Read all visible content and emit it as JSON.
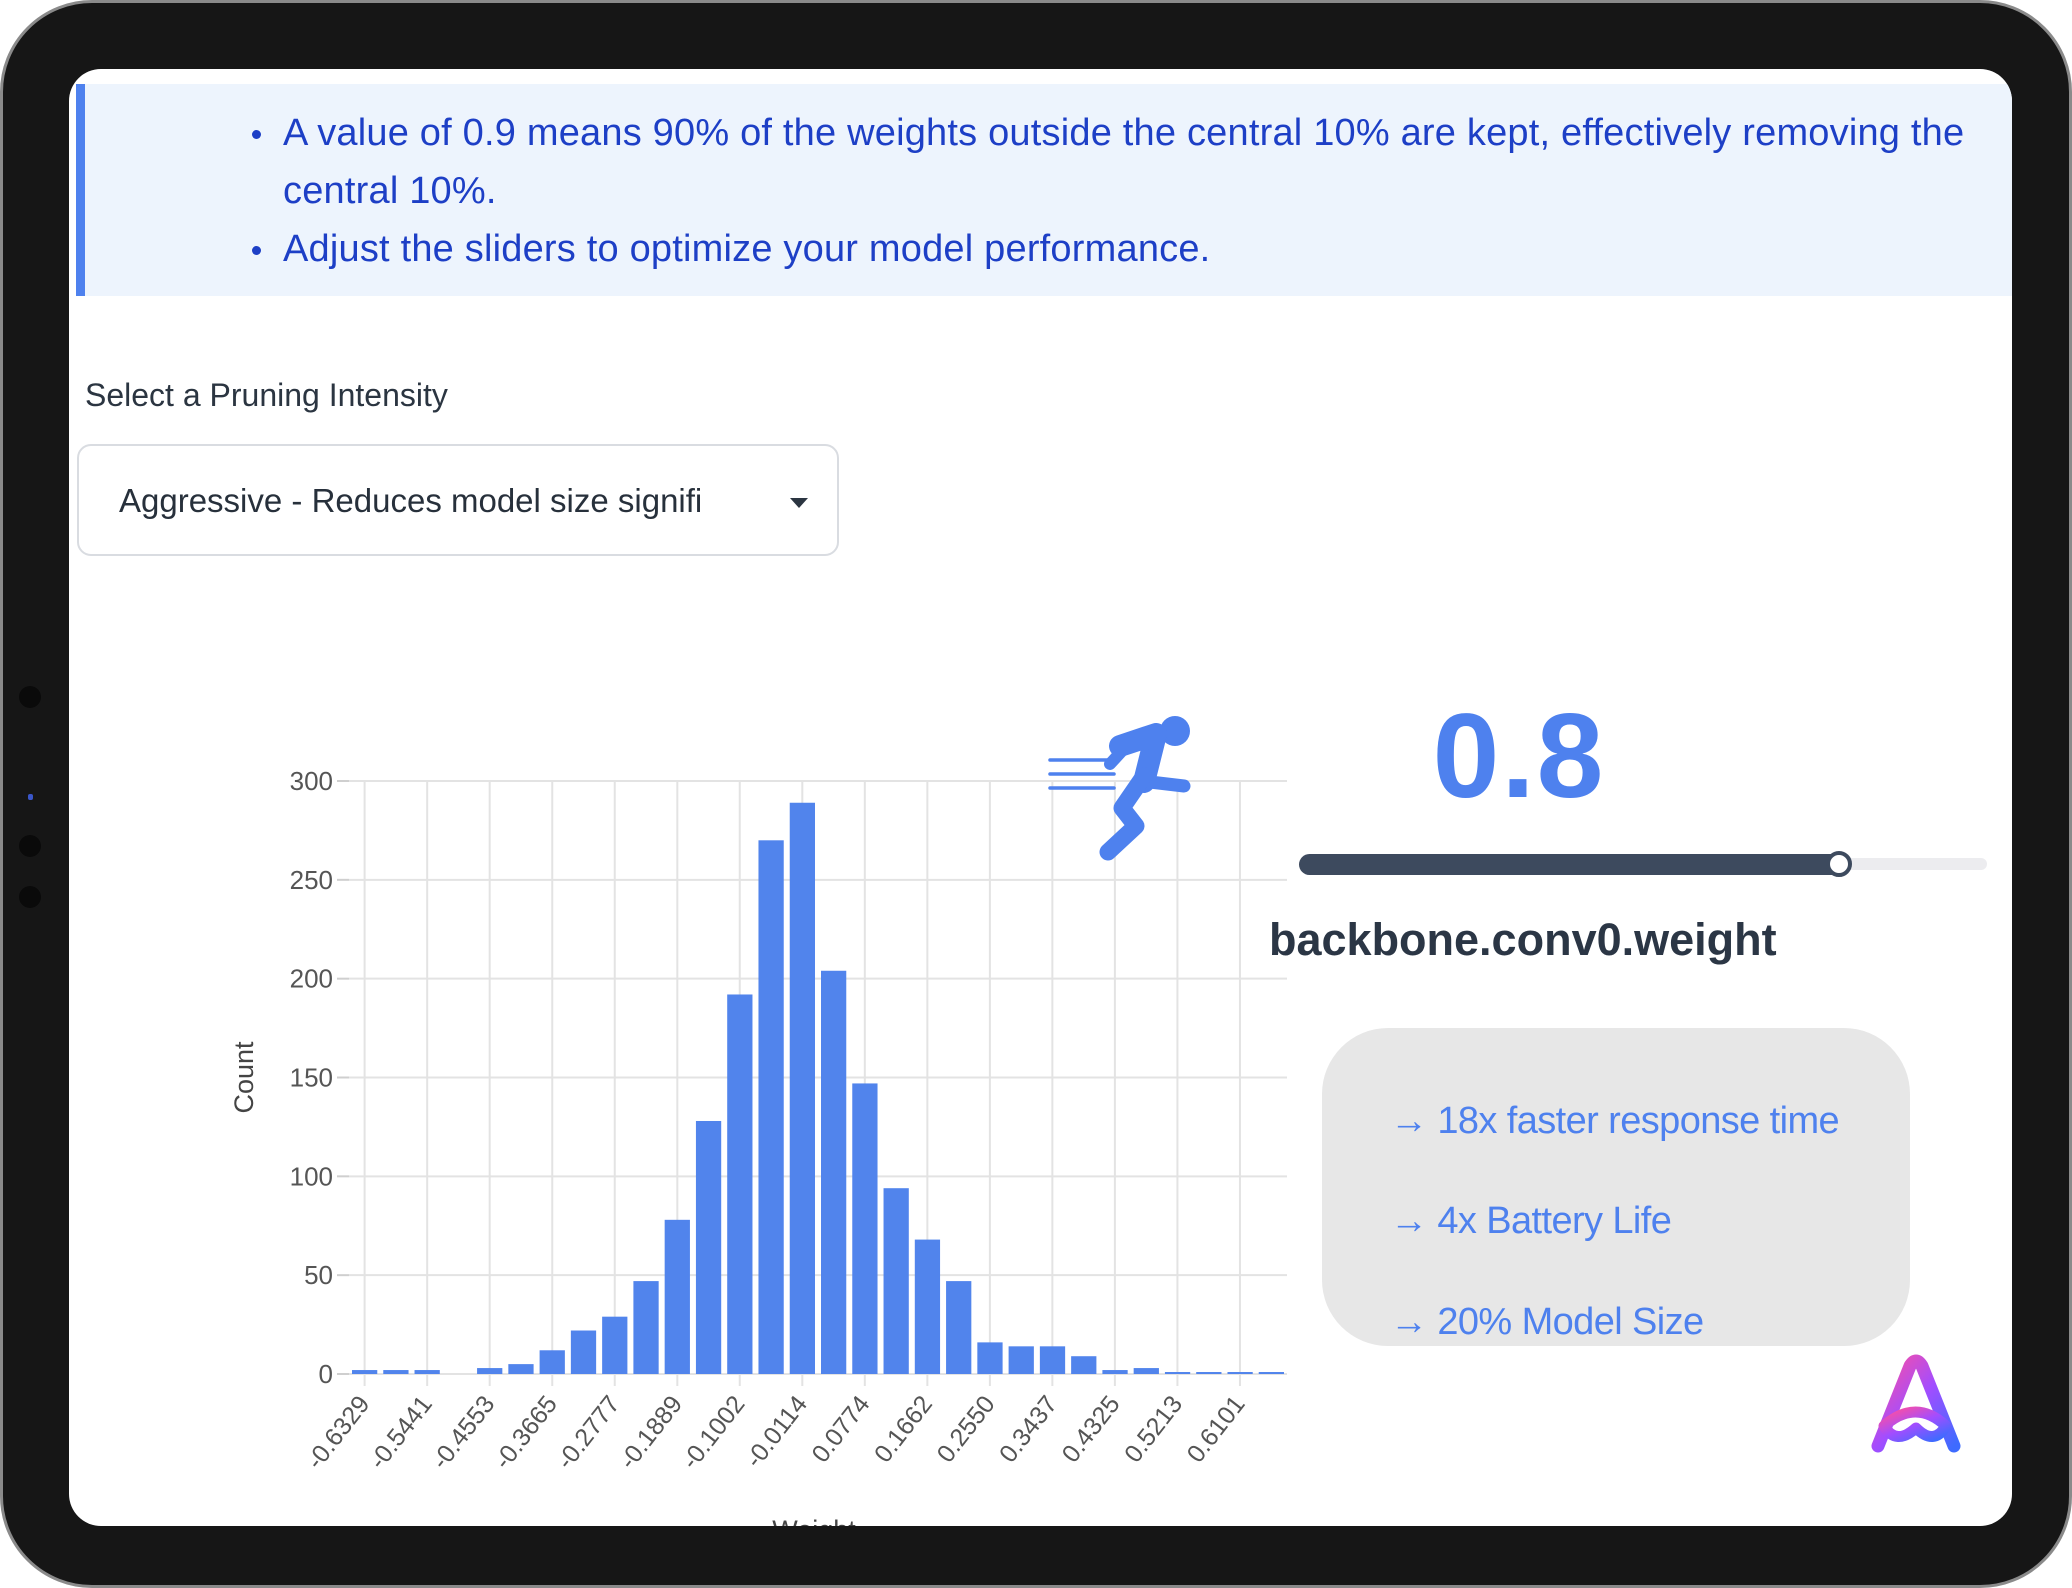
{
  "callout": {
    "items": [
      "A value of 0.9 means 90% of the weights outside the central 10% are kept, effectively removing the central 10%.",
      "Adjust the sliders to optimize your model performance."
    ]
  },
  "pruning": {
    "label": "Select a Pruning Intensity",
    "selected": "Aggressive - Reduces model size signifi"
  },
  "chart_data": {
    "type": "bar",
    "xlabel": "Weight",
    "ylabel": "Count",
    "ylim": [
      0,
      300
    ],
    "yticks": [
      0,
      50,
      100,
      150,
      200,
      250,
      300
    ],
    "grid": true,
    "tick_labels": [
      "-0.6329",
      "-0.5441",
      "-0.4553",
      "-0.3665",
      "-0.2777",
      "-0.1889",
      "-0.1002",
      "-0.0114",
      "0.0774",
      "0.1662",
      "0.2550",
      "0.3437",
      "0.4325",
      "0.5213",
      "0.6101"
    ],
    "x_min": -0.6551,
    "bin_width": 0.0444,
    "values": [
      2,
      2,
      2,
      0,
      3,
      5,
      12,
      22,
      29,
      47,
      78,
      128,
      192,
      270,
      289,
      204,
      147,
      94,
      68,
      47,
      16,
      14,
      14,
      9,
      2,
      3,
      1,
      1,
      1,
      1
    ],
    "color": "#5184ec"
  },
  "run_icon": {
    "icon": "running-person-icon",
    "color": "#4e81ee"
  },
  "intensity": {
    "value": "0.8",
    "level": 0.8
  },
  "layer": {
    "name": "backbone.conv0.weight"
  },
  "benefits": [
    "→ 18x faster response time",
    "→ 4x Battery Life",
    "→ 20% Model Size"
  ],
  "colors": {
    "accent": "#4e81ee",
    "callout_bg": "#edf4fd",
    "callout_text": "#1d3fc6",
    "slider_fill": "#3d4a5e"
  }
}
